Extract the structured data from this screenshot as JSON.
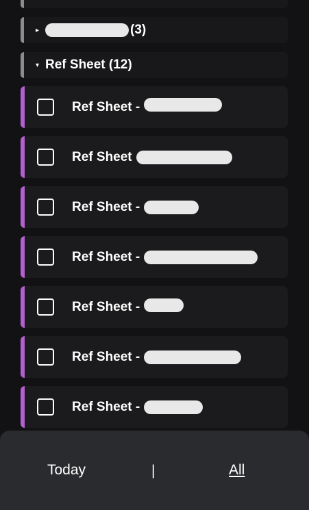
{
  "groups": [
    {
      "label": "(3)",
      "caret": "▸",
      "collapsed": true
    },
    {
      "label": "Ref Sheet (12)",
      "caret": "▾",
      "collapsed": false
    }
  ],
  "tasks": [
    {
      "title": "Ref Sheet -",
      "checked": false
    },
    {
      "title": "Ref Sheet",
      "checked": false
    },
    {
      "title": "Ref Sheet -",
      "checked": false
    },
    {
      "title": "Ref Sheet -",
      "checked": false
    },
    {
      "title": "Ref Sheet -",
      "checked": false
    },
    {
      "title": "Ref Sheet -",
      "checked": false
    },
    {
      "title": "Ref Sheet -",
      "checked": false
    }
  ],
  "footer": {
    "today_label": "Today",
    "separator": "|",
    "all_label": "All"
  },
  "colors": {
    "background": "#121214",
    "row_bg": "#1b1b1d",
    "accent": "#b45fd0",
    "group_edge": "#8c8c8c",
    "footer_bg": "#2a2b2e"
  }
}
